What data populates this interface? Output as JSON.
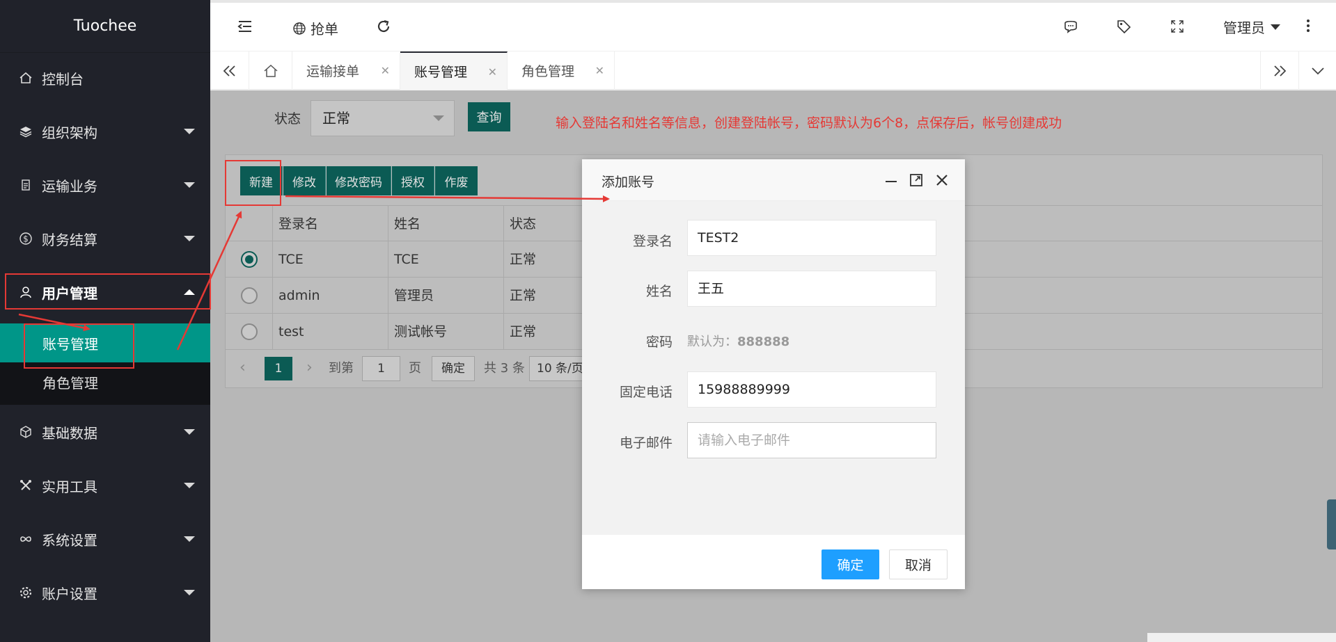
{
  "app": {
    "title": "Tuochee"
  },
  "sidebar": {
    "items": [
      {
        "label": "控制台",
        "icon": "home-icon"
      },
      {
        "label": "组织架构",
        "icon": "layers-icon"
      },
      {
        "label": "运输业务",
        "icon": "doc-icon"
      },
      {
        "label": "财务结算",
        "icon": "dollar-icon"
      },
      {
        "label": "用户管理",
        "icon": "user-icon"
      },
      {
        "label": "基础数据",
        "icon": "cube-icon"
      },
      {
        "label": "实用工具",
        "icon": "tools-icon"
      },
      {
        "label": "系统设置",
        "icon": "infinity-icon"
      },
      {
        "label": "账户设置",
        "icon": "gear-icon"
      }
    ],
    "subitems": [
      {
        "label": "账号管理"
      },
      {
        "label": "角色管理"
      }
    ]
  },
  "header": {
    "grab_orders": "抢单",
    "user": "管理员"
  },
  "tabs": [
    {
      "label": "运输接单"
    },
    {
      "label": "账号管理"
    },
    {
      "label": "角色管理"
    }
  ],
  "filter": {
    "status_label": "状态",
    "status_value": "正常",
    "query_label": "查询"
  },
  "hint": "输入登陆名和姓名等信息，创建登陆帐号，密码默认为6个8，点保存后，帐号创建成功",
  "toolbar": {
    "new": "新建",
    "edit": "修改",
    "change_password": "修改密码",
    "authorize": "授权",
    "void": "作废"
  },
  "table": {
    "columns": [
      "登录名",
      "姓名",
      "状态"
    ],
    "rows": [
      {
        "login": "TCE",
        "name": "TCE",
        "status": "正常",
        "selected": true
      },
      {
        "login": "admin",
        "name": "管理员",
        "status": "正常",
        "selected": false
      },
      {
        "login": "test",
        "name": "测试帐号",
        "status": "正常",
        "selected": false
      }
    ]
  },
  "pager": {
    "current": "1",
    "goto_label": "到第",
    "goto_value": "1",
    "page_label": "页",
    "ok": "确定",
    "total": "共 3 条",
    "page_size": "10 条/页"
  },
  "modal": {
    "title": "添加账号",
    "fields": {
      "login_label": "登录名",
      "login_value": "TEST2",
      "name_label": "姓名",
      "name_value": "王五",
      "password_label": "密码",
      "password_note": "默认为：",
      "password_default": "888888",
      "phone_label": "固定电话",
      "phone_value": "15988889999",
      "email_label": "电子邮件",
      "email_placeholder": "请输入电子邮件"
    },
    "ok": "确定",
    "cancel": "取消"
  },
  "colors": {
    "sidebar_bg": "#20222a",
    "accent": "#009688",
    "primary_button": "#1e9fff",
    "annotation": "#e53935"
  }
}
